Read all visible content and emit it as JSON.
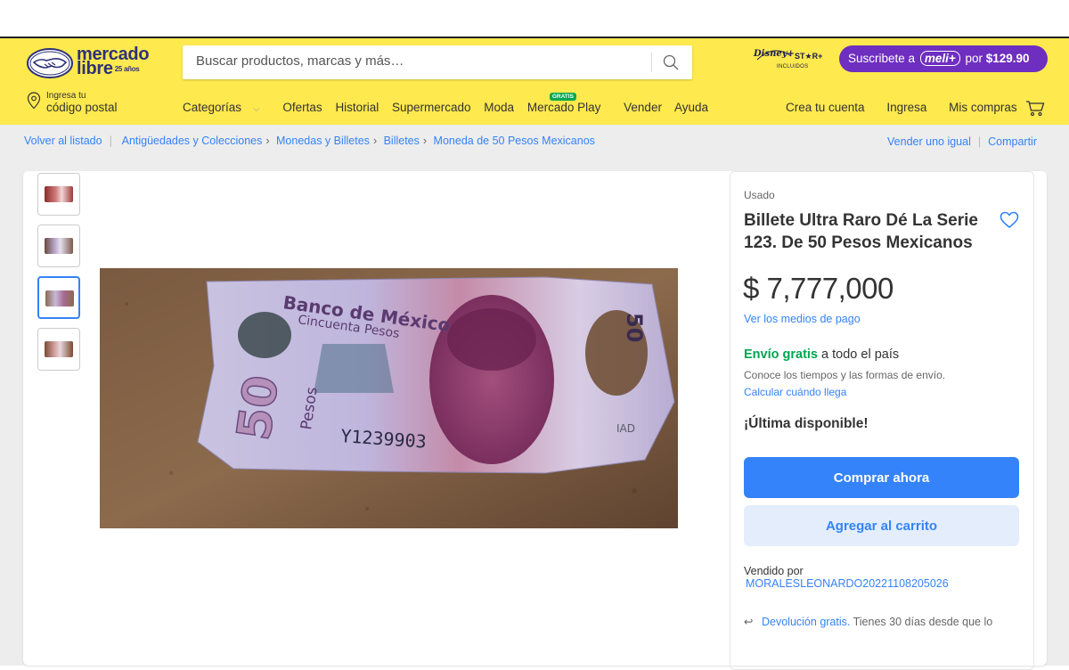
{
  "header": {
    "logo_line1": "mercado",
    "logo_line2": "libre",
    "logo_tag": "25 años",
    "search_placeholder": "Buscar productos, marcas y más…",
    "promo": {
      "disney": "Disney+",
      "star": "ST★R+",
      "included": "INCLUIDOS",
      "subscribe_prefix": "Suscribete a",
      "meli": "meli+",
      "por": "por",
      "price": "$129.90"
    },
    "location_line1": "Ingresa tu",
    "location_line2": "código postal",
    "nav": {
      "categorias": "Categorías",
      "ofertas": "Ofertas",
      "historial": "Historial",
      "supermercado": "Supermercado",
      "moda": "Moda",
      "mercado_play": "Mercado Play",
      "gratis_badge": "GRATIS",
      "vender": "Vender",
      "ayuda": "Ayuda"
    },
    "user_nav": {
      "crea": "Crea tu cuenta",
      "ingresa": "Ingresa",
      "compras": "Mis compras"
    }
  },
  "breadcrumb": {
    "back": "Volver al listado",
    "items": [
      "Antigüedades y Colecciones",
      "Monedas y Billetes",
      "Billetes",
      "Moneda de 50 Pesos Mexicanos"
    ],
    "sell_same": "Vender uno igual",
    "share": "Compartir"
  },
  "product": {
    "condition": "Usado",
    "title": "Billete Ultra Raro Dé La Serie 123. De 50 Pesos Mexicanos",
    "price": "$ 7,777,000",
    "payment_link": "Ver los medios de pago",
    "shipping_free": "Envío gratis",
    "shipping_rest": "a todo el país",
    "shipping_sub": "Conoce los tiempos y las formas de envío.",
    "shipping_link": "Calcular cuándo llega",
    "stock": "¡Última disponible!",
    "buy_now": "Comprar ahora",
    "add_to_cart": "Agregar al carrito",
    "sold_by_label": "Vendido por",
    "seller": "MORALESLEONARDO20221108205026",
    "return_link": "Devolución gratis.",
    "return_text": "Tienes 30 días desde que lo"
  },
  "banknote": {
    "bank": "Banco de México",
    "denomination_text": "Cincuenta Pesos",
    "value": "50",
    "pesos": "Pesos",
    "serial": "Y1239903",
    "series": "IAD"
  },
  "colors": {
    "header_yellow": "#fee94e",
    "link_blue": "#3483fa",
    "green": "#00a650",
    "meli_purple": "#6e2ebf"
  }
}
